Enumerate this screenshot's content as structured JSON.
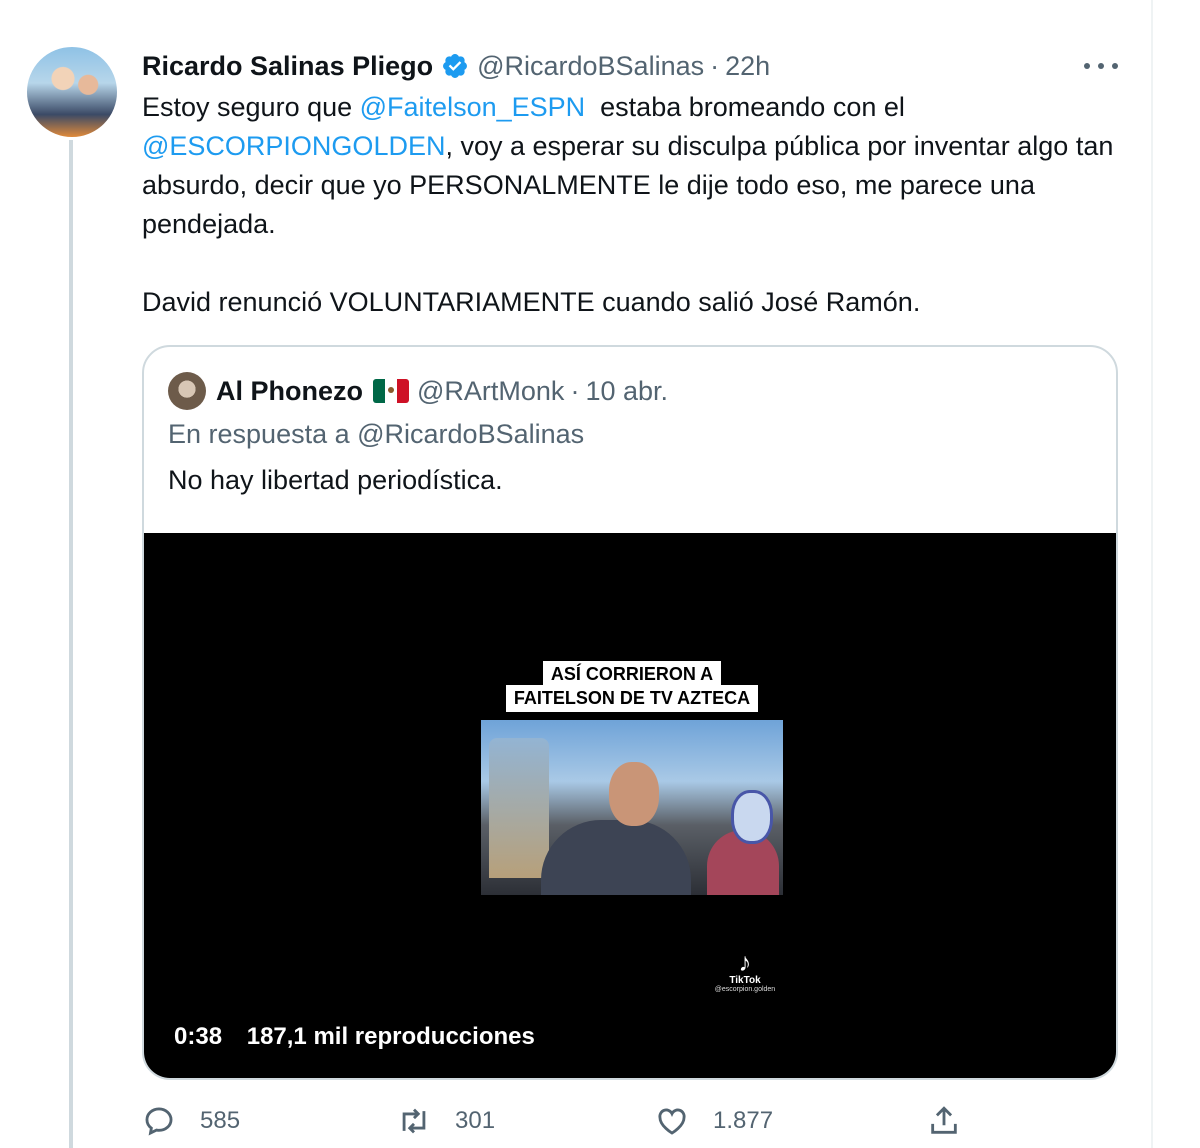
{
  "tweet": {
    "author_name": "Ricardo Salinas Pliego",
    "handle": "@RicardoBSalinas",
    "separator": "·",
    "time": "22h",
    "verified": true,
    "text": {
      "p1_a": "Estoy seguro que ",
      "mention1": "@Faitelson_ESPN",
      "p1_b": "  estaba bromeando con el ",
      "mention2": "@ESCORPIONGOLDEN",
      "p1_c": ", voy a esperar su disculpa pública por inventar algo tan absurdo, decir que yo PERSONALMENTE le dije todo eso, me parece una pendejada.",
      "p2": "David renunció VOLUNTARIAMENTE cuando salió José Ramón."
    }
  },
  "quoted": {
    "author_name": "Al Phonezo",
    "flag": "mexico-flag",
    "handle": "@RArtMonk",
    "separator": "·",
    "time": "10 abr.",
    "reply_to": "En respuesta a @RicardoBSalinas",
    "text": "No hay libertad periodística.",
    "video": {
      "caption_line1": "ASÍ CORRIERON A",
      "caption_line2": "FAITELSON DE TV AZTECA",
      "watermark": "TikTok",
      "watermark_user": "@escorpion.golden",
      "duration": "0:38",
      "views": "187,1 mil reproducciones"
    }
  },
  "actions": {
    "replies": "585",
    "retweets": "301",
    "likes": "1.877"
  },
  "colors": {
    "link": "#1d9bf0",
    "secondary_text": "#536471",
    "border": "#cfd9de"
  }
}
